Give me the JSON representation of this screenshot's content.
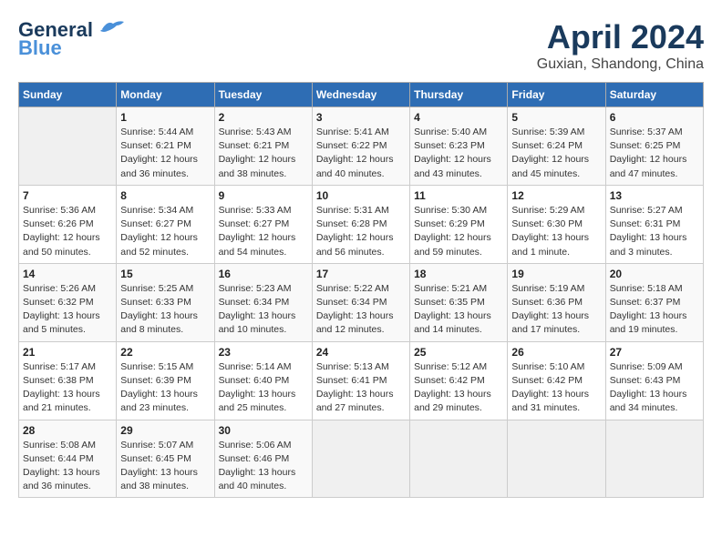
{
  "header": {
    "logo_line1": "General",
    "logo_line2": "Blue",
    "month_title": "April 2024",
    "subtitle": "Guxian, Shandong, China"
  },
  "days_of_week": [
    "Sunday",
    "Monday",
    "Tuesday",
    "Wednesday",
    "Thursday",
    "Friday",
    "Saturday"
  ],
  "weeks": [
    [
      {
        "day": "",
        "info": ""
      },
      {
        "day": "1",
        "info": "Sunrise: 5:44 AM\nSunset: 6:21 PM\nDaylight: 12 hours\nand 36 minutes."
      },
      {
        "day": "2",
        "info": "Sunrise: 5:43 AM\nSunset: 6:21 PM\nDaylight: 12 hours\nand 38 minutes."
      },
      {
        "day": "3",
        "info": "Sunrise: 5:41 AM\nSunset: 6:22 PM\nDaylight: 12 hours\nand 40 minutes."
      },
      {
        "day": "4",
        "info": "Sunrise: 5:40 AM\nSunset: 6:23 PM\nDaylight: 12 hours\nand 43 minutes."
      },
      {
        "day": "5",
        "info": "Sunrise: 5:39 AM\nSunset: 6:24 PM\nDaylight: 12 hours\nand 45 minutes."
      },
      {
        "day": "6",
        "info": "Sunrise: 5:37 AM\nSunset: 6:25 PM\nDaylight: 12 hours\nand 47 minutes."
      }
    ],
    [
      {
        "day": "7",
        "info": "Sunrise: 5:36 AM\nSunset: 6:26 PM\nDaylight: 12 hours\nand 50 minutes."
      },
      {
        "day": "8",
        "info": "Sunrise: 5:34 AM\nSunset: 6:27 PM\nDaylight: 12 hours\nand 52 minutes."
      },
      {
        "day": "9",
        "info": "Sunrise: 5:33 AM\nSunset: 6:27 PM\nDaylight: 12 hours\nand 54 minutes."
      },
      {
        "day": "10",
        "info": "Sunrise: 5:31 AM\nSunset: 6:28 PM\nDaylight: 12 hours\nand 56 minutes."
      },
      {
        "day": "11",
        "info": "Sunrise: 5:30 AM\nSunset: 6:29 PM\nDaylight: 12 hours\nand 59 minutes."
      },
      {
        "day": "12",
        "info": "Sunrise: 5:29 AM\nSunset: 6:30 PM\nDaylight: 13 hours\nand 1 minute."
      },
      {
        "day": "13",
        "info": "Sunrise: 5:27 AM\nSunset: 6:31 PM\nDaylight: 13 hours\nand 3 minutes."
      }
    ],
    [
      {
        "day": "14",
        "info": "Sunrise: 5:26 AM\nSunset: 6:32 PM\nDaylight: 13 hours\nand 5 minutes."
      },
      {
        "day": "15",
        "info": "Sunrise: 5:25 AM\nSunset: 6:33 PM\nDaylight: 13 hours\nand 8 minutes."
      },
      {
        "day": "16",
        "info": "Sunrise: 5:23 AM\nSunset: 6:34 PM\nDaylight: 13 hours\nand 10 minutes."
      },
      {
        "day": "17",
        "info": "Sunrise: 5:22 AM\nSunset: 6:34 PM\nDaylight: 13 hours\nand 12 minutes."
      },
      {
        "day": "18",
        "info": "Sunrise: 5:21 AM\nSunset: 6:35 PM\nDaylight: 13 hours\nand 14 minutes."
      },
      {
        "day": "19",
        "info": "Sunrise: 5:19 AM\nSunset: 6:36 PM\nDaylight: 13 hours\nand 17 minutes."
      },
      {
        "day": "20",
        "info": "Sunrise: 5:18 AM\nSunset: 6:37 PM\nDaylight: 13 hours\nand 19 minutes."
      }
    ],
    [
      {
        "day": "21",
        "info": "Sunrise: 5:17 AM\nSunset: 6:38 PM\nDaylight: 13 hours\nand 21 minutes."
      },
      {
        "day": "22",
        "info": "Sunrise: 5:15 AM\nSunset: 6:39 PM\nDaylight: 13 hours\nand 23 minutes."
      },
      {
        "day": "23",
        "info": "Sunrise: 5:14 AM\nSunset: 6:40 PM\nDaylight: 13 hours\nand 25 minutes."
      },
      {
        "day": "24",
        "info": "Sunrise: 5:13 AM\nSunset: 6:41 PM\nDaylight: 13 hours\nand 27 minutes."
      },
      {
        "day": "25",
        "info": "Sunrise: 5:12 AM\nSunset: 6:42 PM\nDaylight: 13 hours\nand 29 minutes."
      },
      {
        "day": "26",
        "info": "Sunrise: 5:10 AM\nSunset: 6:42 PM\nDaylight: 13 hours\nand 31 minutes."
      },
      {
        "day": "27",
        "info": "Sunrise: 5:09 AM\nSunset: 6:43 PM\nDaylight: 13 hours\nand 34 minutes."
      }
    ],
    [
      {
        "day": "28",
        "info": "Sunrise: 5:08 AM\nSunset: 6:44 PM\nDaylight: 13 hours\nand 36 minutes."
      },
      {
        "day": "29",
        "info": "Sunrise: 5:07 AM\nSunset: 6:45 PM\nDaylight: 13 hours\nand 38 minutes."
      },
      {
        "day": "30",
        "info": "Sunrise: 5:06 AM\nSunset: 6:46 PM\nDaylight: 13 hours\nand 40 minutes."
      },
      {
        "day": "",
        "info": ""
      },
      {
        "day": "",
        "info": ""
      },
      {
        "day": "",
        "info": ""
      },
      {
        "day": "",
        "info": ""
      }
    ]
  ]
}
